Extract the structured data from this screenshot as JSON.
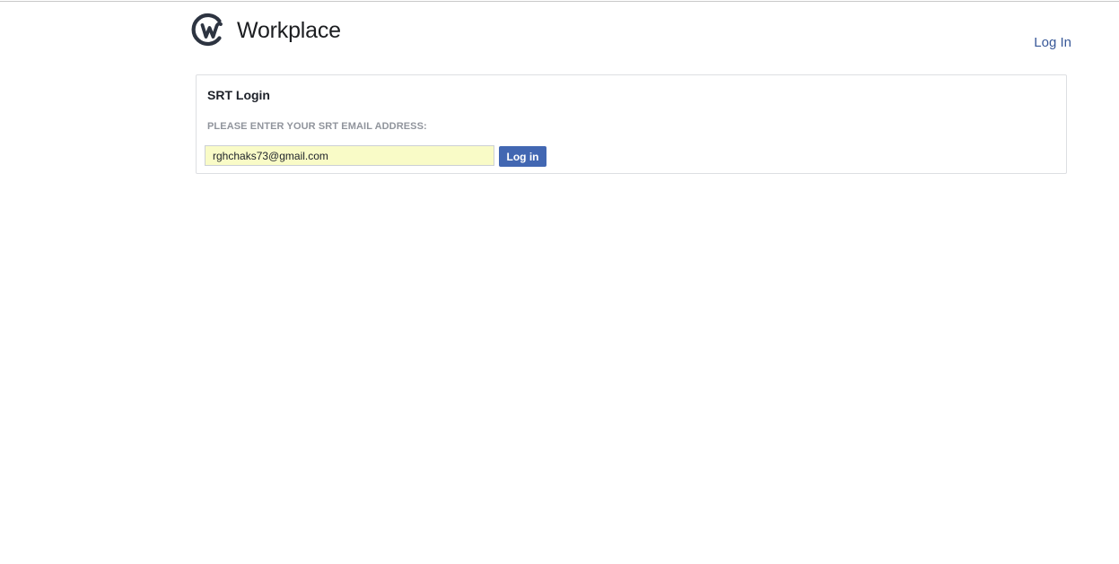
{
  "header": {
    "brand_name": "Workplace",
    "brand_icon": "workplace-logo-icon",
    "login_link": "Log In"
  },
  "login_panel": {
    "title": "SRT Login",
    "email_label": "PLEASE ENTER YOUR SRT EMAIL ADDRESS:",
    "email_value": "rghchaks73@gmail.com",
    "submit_label": "Log in"
  },
  "colors": {
    "link": "#385898",
    "button": "#4267b2",
    "input_autofill_bg": "#f9fbc7",
    "logo": "#2d3441"
  }
}
